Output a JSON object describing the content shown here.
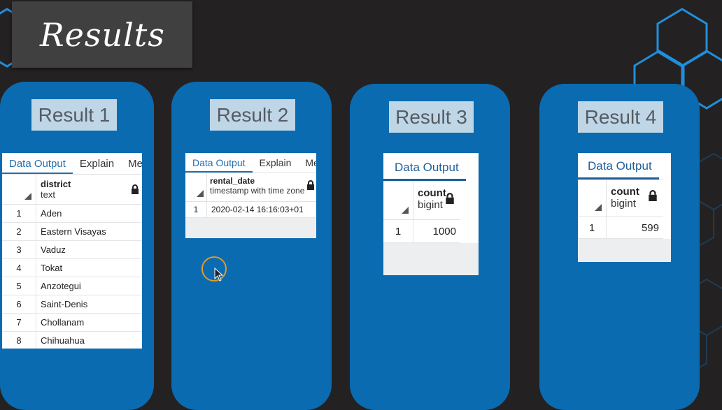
{
  "page": {
    "title": "Results"
  },
  "results": [
    {
      "label": "Result 1",
      "tabs": [
        "Data Output",
        "Explain",
        "Mes"
      ],
      "column": {
        "name": "district",
        "type": "text"
      },
      "rows": [
        {
          "n": "1",
          "v": "Aden"
        },
        {
          "n": "2",
          "v": "Eastern Visayas"
        },
        {
          "n": "3",
          "v": "Vaduz"
        },
        {
          "n": "4",
          "v": "Tokat"
        },
        {
          "n": "5",
          "v": "Anzotegui"
        },
        {
          "n": "6",
          "v": "Saint-Denis"
        },
        {
          "n": "7",
          "v": "Chollanam"
        },
        {
          "n": "8",
          "v": "Chihuahua"
        }
      ]
    },
    {
      "label": "Result 2",
      "tabs": [
        "Data Output",
        "Explain",
        "Mes"
      ],
      "column": {
        "name": "rental_date",
        "type": "timestamp with time zone"
      },
      "rows": [
        {
          "n": "1",
          "v": "2020-02-14 16:16:03+01"
        }
      ]
    },
    {
      "label": "Result 3",
      "tabs": [
        "Data Output"
      ],
      "column": {
        "name": "count",
        "type": "bigint"
      },
      "rows": [
        {
          "n": "1",
          "v": "1000"
        }
      ]
    },
    {
      "label": "Result 4",
      "tabs": [
        "Data Output"
      ],
      "column": {
        "name": "count",
        "type": "bigint"
      },
      "rows": [
        {
          "n": "1",
          "v": "599"
        }
      ]
    }
  ],
  "colors": {
    "background": "#242122",
    "panel": "#0a6bb1",
    "label_bg": "#bfd6e7",
    "accent": "#1f6fb2",
    "hex_outline": "#1f8fdc"
  },
  "icons": [
    "lock-icon",
    "sort-corner-icon",
    "mouse-cursor-icon",
    "cursor-highlight-ring"
  ]
}
